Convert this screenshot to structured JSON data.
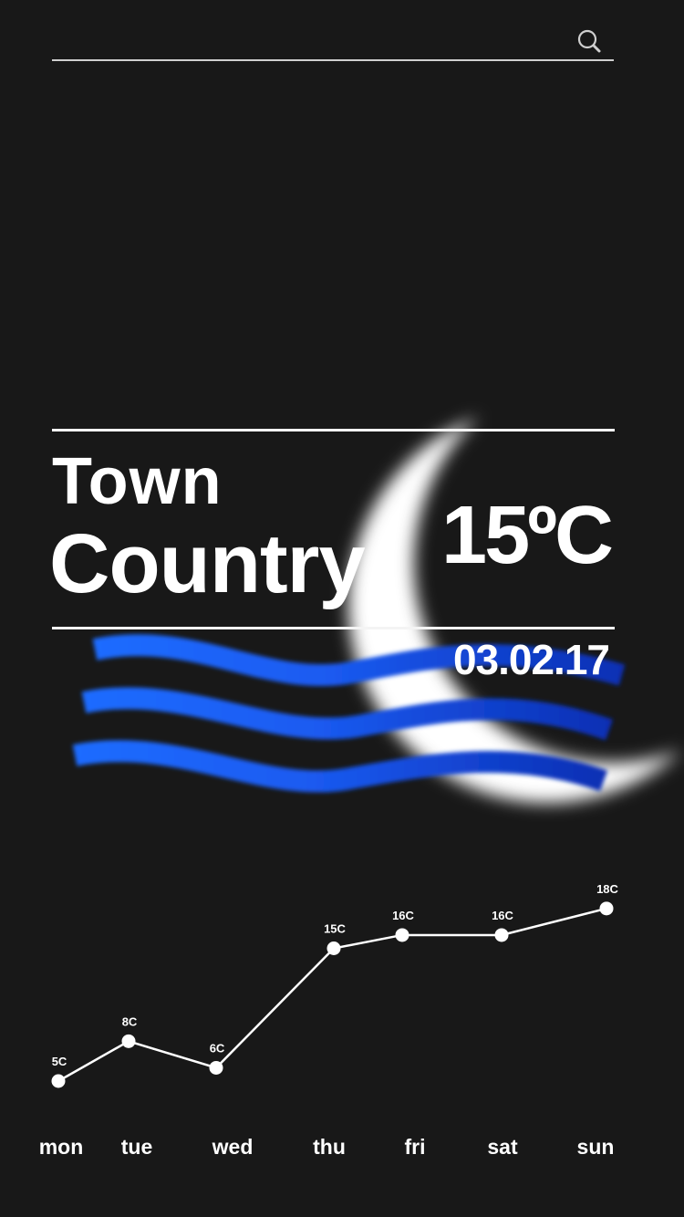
{
  "search": {
    "value": "",
    "placeholder": "",
    "icon": "search-icon"
  },
  "location": {
    "town": "Town",
    "country": "Country"
  },
  "weather": {
    "temperature": "15ºC",
    "date": "03.02.17",
    "icon": "moon-waves-icon"
  },
  "colors": {
    "background": "#181818",
    "text": "#ffffff",
    "wave": "#1a5ef0",
    "moon": "#ffffff"
  },
  "chart_data": {
    "type": "line",
    "categories": [
      "mon",
      "tue",
      "wed",
      "thu",
      "fri",
      "sat",
      "sun"
    ],
    "values": [
      5,
      8,
      6,
      15,
      16,
      16,
      18
    ],
    "value_labels": [
      "5C",
      "8C",
      "6C",
      "15C",
      "16C",
      "16C",
      "18C"
    ],
    "title": "",
    "xlabel": "",
    "ylabel": "",
    "grid": false
  }
}
